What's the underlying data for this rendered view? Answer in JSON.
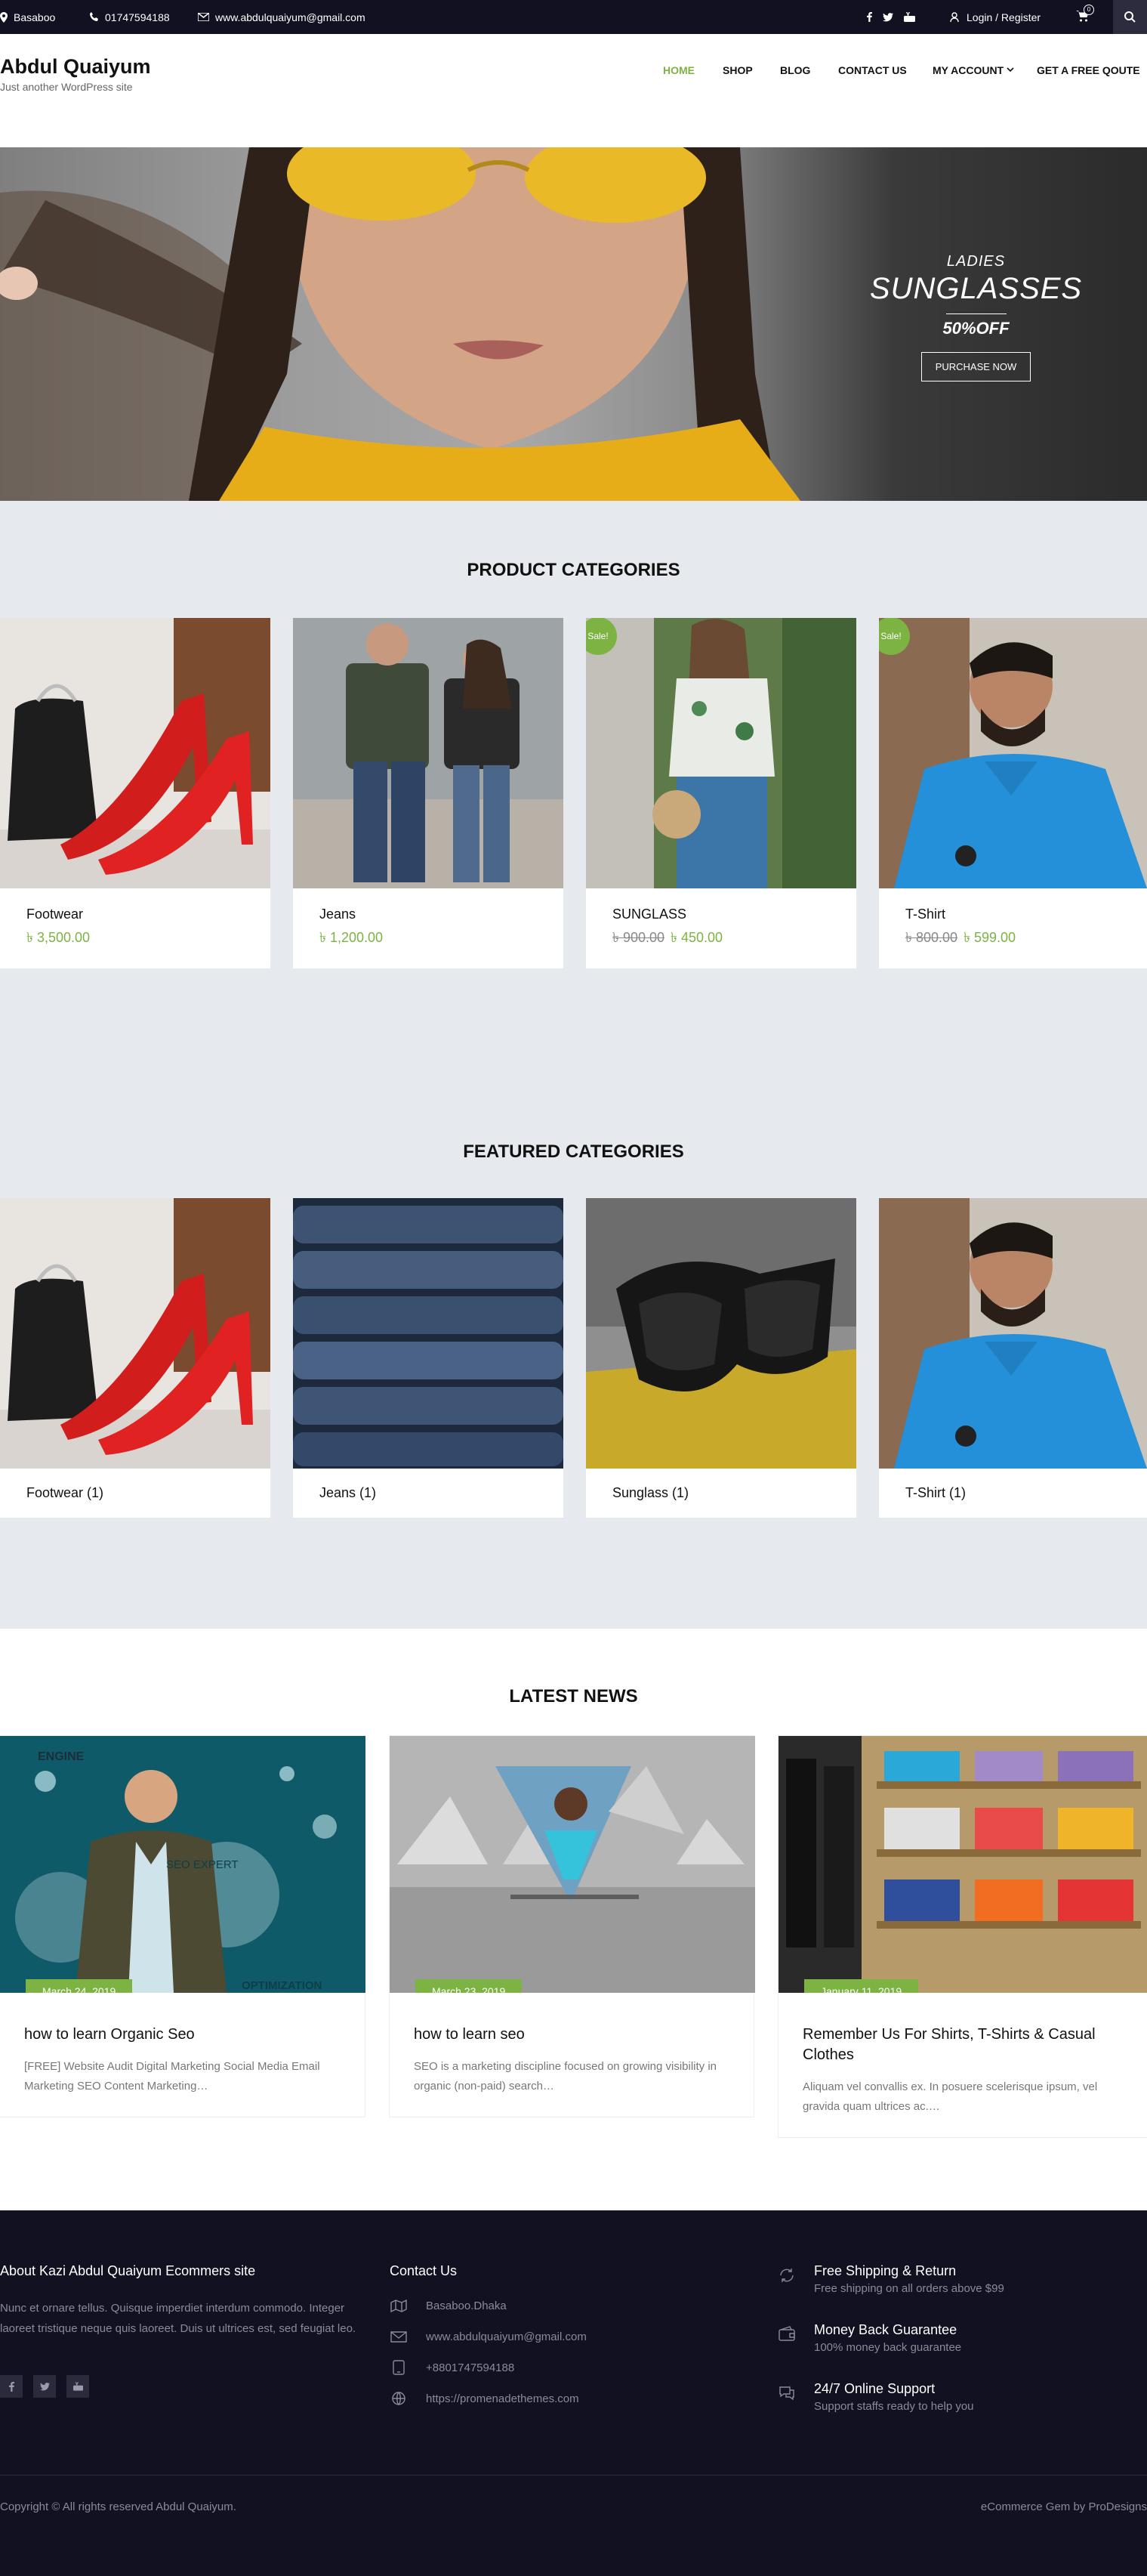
{
  "topbar": {
    "location": "Basaboo",
    "phone": "01747594188",
    "email": "www.abdulquaiyum@gmail.com",
    "login": "Login / Register",
    "cart_count": "0"
  },
  "header": {
    "site_title": "Abdul Quaiyum",
    "tagline": "Just another WordPress site",
    "nav": [
      "HOME",
      "SHOP",
      "BLOG",
      "CONTACT US",
      "MY ACCOUNT",
      "GET A FREE QOUTE"
    ]
  },
  "hero": {
    "small": "LADIES",
    "big": "SUNGLASSES",
    "off": "50%OFF",
    "button": "PURCHASE NOW"
  },
  "product_categories": {
    "title": "PRODUCT CATEGORIES",
    "items": [
      {
        "name": "Footwear",
        "price": "৳ 3,500.00",
        "old_price": "",
        "sale": ""
      },
      {
        "name": "Jeans",
        "price": "৳ 1,200.00",
        "old_price": "",
        "sale": ""
      },
      {
        "name": "SUNGLASS",
        "price": "৳ 450.00",
        "old_price": "৳ 900.00",
        "sale": "Sale!"
      },
      {
        "name": "T-Shirt",
        "price": "৳ 599.00",
        "old_price": "৳ 800.00",
        "sale": "Sale!"
      }
    ]
  },
  "featured_categories": {
    "title": "FEATURED CATEGORIES",
    "items": [
      "Footwear (1)",
      "Jeans (1)",
      "Sunglass (1)",
      "T-Shirt (1)"
    ]
  },
  "latest_news": {
    "title": "LATEST NEWS",
    "items": [
      {
        "date": "March 24, 2019",
        "title": "how to learn Organic Seo",
        "excerpt": "[FREE] Website Audit Digital Marketing Social Media Email Marketing SEO Content Marketing…",
        "img_text_1": "ENGINE",
        "img_text_2": "SEO EXPERT",
        "img_text_3": "OPTIMIZATION"
      },
      {
        "date": "March 23, 2019",
        "title": "how to learn seo",
        "excerpt": "SEO is a marketing discipline focused on growing visibility in organic (non-paid) search…"
      },
      {
        "date": "January 11, 2019",
        "title": "Remember Us For Shirts, T-Shirts & Casual Clothes",
        "excerpt": "Aliquam vel convallis ex. In posuere scelerisque ipsum, vel gravida quam ultrices ac.…"
      }
    ]
  },
  "footer": {
    "about_title": "About Kazi Abdul Quaiyum Ecommers site",
    "about_text": "Nunc et ornare tellus. Quisque imperdiet interdum commodo. Integer laoreet tristique neque quis laoreet. Duis ut ultrices est, sed feugiat leo.",
    "contact_title": "Contact Us",
    "contact": [
      "Basaboo.Dhaka",
      "www.abdulquaiyum@gmail.com",
      "+8801747594188",
      "https://promenadethemes.com"
    ],
    "features": [
      {
        "title": "Free Shipping & Return",
        "sub": "Free shipping on all orders above $99"
      },
      {
        "title": "Money Back Guarantee",
        "sub": "100% money back guarantee"
      },
      {
        "title": "24/7 Online Support",
        "sub": "Support staffs ready to help you"
      }
    ],
    "copyright": "Copyright © All rights reserved Abdul Quaiyum.",
    "credit": "eCommerce Gem by ProDesigns"
  },
  "colors": {
    "accent": "#7cb342",
    "dark": "#111121",
    "grey_bg": "#e6e9ee"
  }
}
